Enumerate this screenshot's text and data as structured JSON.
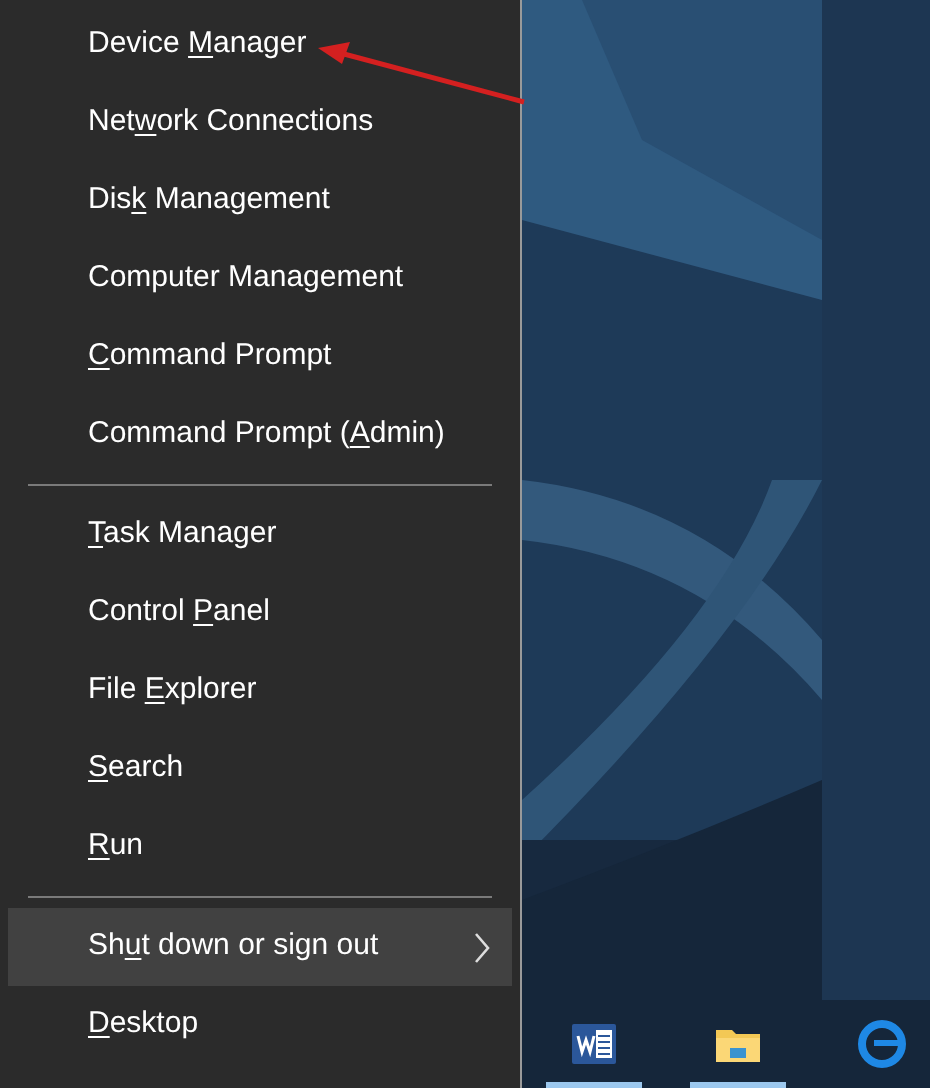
{
  "menu": {
    "items": [
      {
        "kind": "item",
        "label_parts": [
          {
            "text": "Device "
          },
          {
            "text": "M",
            "underlined": true
          },
          {
            "text": "anager"
          }
        ],
        "selected": false,
        "has_submenu": false
      },
      {
        "kind": "item",
        "label_parts": [
          {
            "text": "Net"
          },
          {
            "text": "w",
            "underlined": true
          },
          {
            "text": "ork Connections"
          }
        ],
        "selected": false,
        "has_submenu": false
      },
      {
        "kind": "item",
        "label_parts": [
          {
            "text": "Dis"
          },
          {
            "text": "k",
            "underlined": true
          },
          {
            "text": " Management"
          }
        ],
        "selected": false,
        "has_submenu": false
      },
      {
        "kind": "item",
        "label_parts": [
          {
            "text": "Computer Management"
          }
        ],
        "selected": false,
        "has_submenu": false
      },
      {
        "kind": "item",
        "label_parts": [
          {
            "text": "C",
            "underlined": true
          },
          {
            "text": "ommand Prompt"
          }
        ],
        "selected": false,
        "has_submenu": false
      },
      {
        "kind": "item",
        "label_parts": [
          {
            "text": "Command Prompt ("
          },
          {
            "text": "A",
            "underlined": true
          },
          {
            "text": "dmin)"
          }
        ],
        "selected": false,
        "has_submenu": false
      },
      {
        "kind": "separator"
      },
      {
        "kind": "item",
        "label_parts": [
          {
            "text": "T",
            "underlined": true
          },
          {
            "text": "ask Manager"
          }
        ],
        "selected": false,
        "has_submenu": false
      },
      {
        "kind": "item",
        "label_parts": [
          {
            "text": "Control "
          },
          {
            "text": "P",
            "underlined": true
          },
          {
            "text": "anel"
          }
        ],
        "selected": false,
        "has_submenu": false
      },
      {
        "kind": "item",
        "label_parts": [
          {
            "text": "File "
          },
          {
            "text": "E",
            "underlined": true
          },
          {
            "text": "xplorer"
          }
        ],
        "selected": false,
        "has_submenu": false
      },
      {
        "kind": "item",
        "label_parts": [
          {
            "text": "S",
            "underlined": true
          },
          {
            "text": "earch"
          }
        ],
        "selected": false,
        "has_submenu": false
      },
      {
        "kind": "item",
        "label_parts": [
          {
            "text": "R",
            "underlined": true
          },
          {
            "text": "un"
          }
        ],
        "selected": false,
        "has_submenu": false
      },
      {
        "kind": "separator"
      },
      {
        "kind": "item",
        "label_parts": [
          {
            "text": "Sh"
          },
          {
            "text": "u",
            "underlined": true
          },
          {
            "text": "t down or sign out"
          }
        ],
        "selected": true,
        "has_submenu": true
      },
      {
        "kind": "item",
        "label_parts": [
          {
            "text": "D",
            "underlined": true
          },
          {
            "text": "esktop"
          }
        ],
        "selected": false,
        "has_submenu": false
      }
    ]
  },
  "annotation": {
    "kind": "arrow"
  },
  "taskbar": {
    "icons": [
      {
        "kind": "document",
        "active": true
      },
      {
        "kind": "folder",
        "active": true
      },
      {
        "kind": "browser",
        "active": false
      }
    ]
  }
}
